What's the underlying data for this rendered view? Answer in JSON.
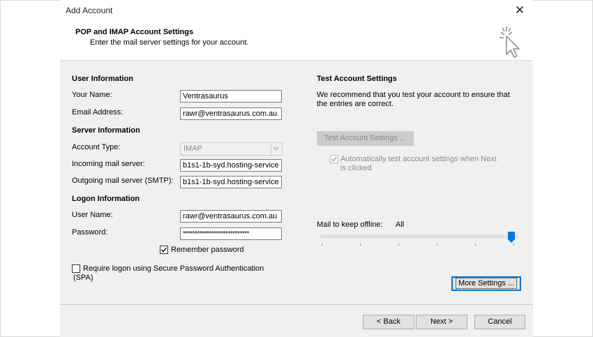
{
  "window": {
    "title": "Add Account",
    "close_glyph": "✕"
  },
  "header": {
    "title": "POP and IMAP Account Settings",
    "subtitle": "Enter the mail server settings for your account.",
    "icon": "wizard-cursor-icon"
  },
  "user_info": {
    "section": "User Information",
    "name_label": "Your Name:",
    "name_value": "Ventrasaurus",
    "email_label": "Email Address:",
    "email_value": "rawr@ventrasaurus.com.au"
  },
  "server_info": {
    "section": "Server Information",
    "account_type_label": "Account Type:",
    "account_type_value": "IMAP",
    "incoming_label": "Incoming mail server:",
    "incoming_value": "b1s1-1b-syd.hosting-service",
    "outgoing_label": "Outgoing mail server (SMTP):",
    "outgoing_value": "b1s1-1b-syd.hosting-service"
  },
  "logon_info": {
    "section": "Logon Information",
    "username_label": "User Name:",
    "username_value": "rawr@ventrasaurus.com.au",
    "password_label": "Password:",
    "password_value": "****************************",
    "remember_label": "Remember password",
    "remember_checked": true,
    "spa_label_line1": "Require logon using Secure Password Authentication",
    "spa_label_line2": "(SPA)",
    "spa_checked": false
  },
  "test_settings": {
    "section": "Test Account Settings",
    "desc_line1": "We recommend that you test your account to ensure that",
    "desc_line2": "the entries are correct.",
    "button": "Test Account Settings ...",
    "auto_label_line1": "Automatically test account settings when Next",
    "auto_label_line2": "is clicked",
    "auto_checked": true
  },
  "offline": {
    "label": "Mail to keep offline:",
    "value": "All",
    "slider_level": 1.0
  },
  "buttons": {
    "more_settings": "More Settings ...",
    "back": "< Back",
    "next": "Next >",
    "cancel": "Cancel"
  },
  "colors": {
    "accent": "#0078d7",
    "dialog_bg": "#f0f0f0"
  }
}
